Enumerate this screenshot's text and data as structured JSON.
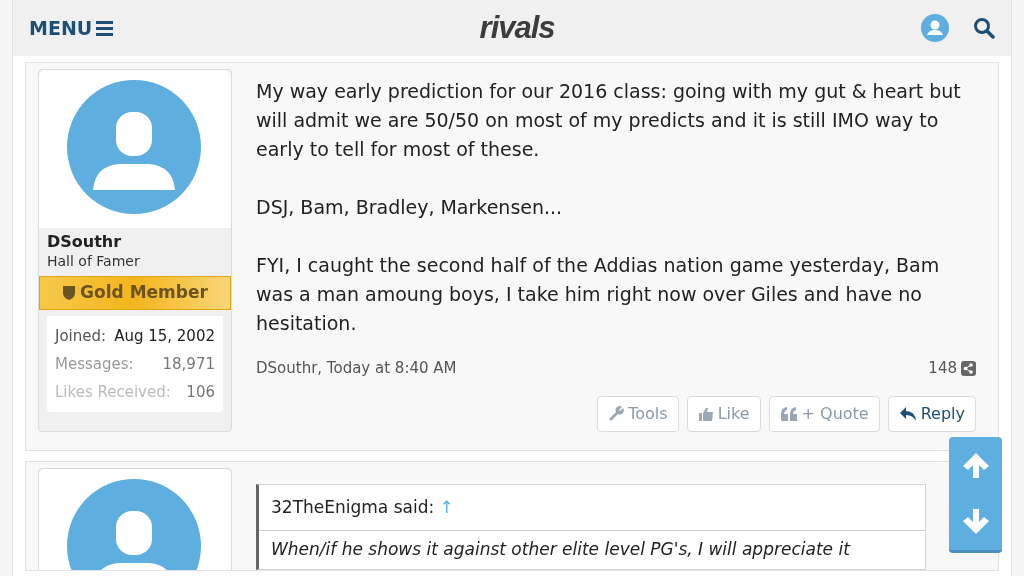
{
  "header": {
    "menu": "MENU",
    "logo": "rivals"
  },
  "posts": [
    {
      "author": "DSouthr",
      "title": "Hall of Famer",
      "banner": "Gold Member",
      "stats": [
        {
          "label": "Joined:",
          "value": "Aug 15, 2002"
        },
        {
          "label": "Messages:",
          "value": "18,971"
        },
        {
          "label": "Likes Received:",
          "value": "106"
        }
      ],
      "paragraphs": [
        "My way early prediction for our 2016 class: going with my gut & heart but will admit we are 50/50 on most of my predicts and it is still IMO way to early to tell for most of these.",
        "DSJ, Bam, Bradley, Markensen...",
        "FYI, I caught the second half of the Addias nation game yesterday, Bam was a man amoung boys, I take him right now over Giles and have no hesitation."
      ],
      "meta": "DSouthr, Today at 8:40 AM",
      "post_number": "148",
      "actions": [
        {
          "kind": "tools",
          "label": "Tools"
        },
        {
          "kind": "like",
          "label": "Like"
        },
        {
          "kind": "quote",
          "label": "+ Quote"
        },
        {
          "kind": "reply",
          "label": "Reply"
        }
      ]
    },
    {
      "quote_author": "32TheEnigma said:",
      "quote_link": "↑",
      "quote_text": "When/if he shows it against other elite level PG's, I will appreciate it"
    }
  ]
}
